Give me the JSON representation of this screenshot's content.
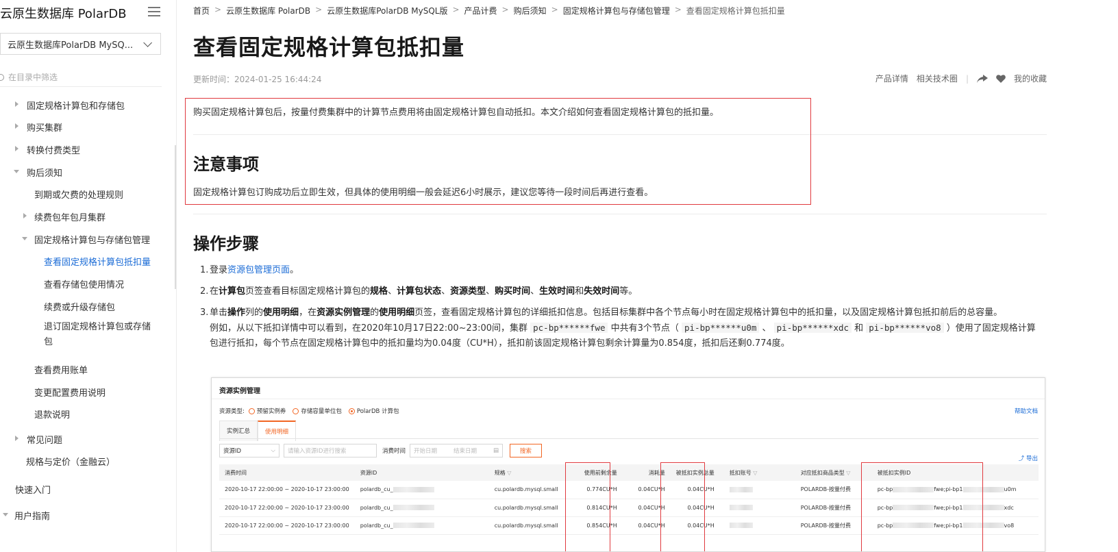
{
  "sidebar": {
    "product_title": "云原生数据库 PolarDB",
    "product_select": "云原生数据库PolarDB MySQ...",
    "filter_placeholder": "在目录中筛选",
    "items": [
      {
        "label": "固定规格计算包和存储包"
      },
      {
        "label": "购买集群"
      },
      {
        "label": "转换付费类型"
      },
      {
        "label": "购后须知"
      },
      {
        "label": "到期或欠费的处理规则"
      },
      {
        "label": "续费包年包月集群"
      },
      {
        "label": "固定规格计算包与存储包管理"
      },
      {
        "label": "查看固定规格计算包抵扣量"
      },
      {
        "label": "查看存储包使用情况"
      },
      {
        "label": "续费或升级存储包"
      },
      {
        "label": "退订固定规格计算包或存储包"
      },
      {
        "label": "查看费用账单"
      },
      {
        "label": "变更配置费用说明"
      },
      {
        "label": "退款说明"
      },
      {
        "label": "常见问题"
      },
      {
        "label": "规格与定价（金融云）"
      },
      {
        "label": "快速入门"
      },
      {
        "label": "用户指南"
      }
    ]
  },
  "breadcrumb": [
    "首页",
    "云原生数据库 PolarDB",
    "云原生数据库PolarDB MySQL版",
    "产品计费",
    "购后须知",
    "固定规格计算包与存储包管理",
    "查看固定规格计算包抵扣量"
  ],
  "page": {
    "title": "查看固定规格计算包抵扣量",
    "updated": "更新时间：2024-01-25 16:44:24",
    "actions": {
      "product_detail": "产品详情",
      "tech_circle": "相关技术圈",
      "favorites": "我的收藏"
    },
    "intro": "购买固定规格计算包后，按量付费集群中的计算节点费用将由固定规格计算包自动抵扣。本文介绍如何查看固定规格计算包的抵扣量。",
    "notes_heading": "注意事项",
    "notes_text": "固定规格计算包订购成功后立即生效，但具体的使用明细一般会延迟6小时展示，建议您等待一段时间后再进行查看。",
    "steps_heading": "操作步骤",
    "steps": {
      "s1_num": "1.",
      "s1_pre": "登录",
      "s1_link": "资源包管理页面",
      "s1_post": "。",
      "s2_num": "2.",
      "s2_a": "在",
      "s2_b": "计算包",
      "s2_c": "页签查看目标固定规格计算包的",
      "s2_d": "规格",
      "s2_e": "、",
      "s2_f": "计算包状态",
      "s2_g": "、",
      "s2_h": "资源类型",
      "s2_i": "、",
      "s2_j": "购买时间",
      "s2_k": "、",
      "s2_l": "生效时间",
      "s2_m": "和",
      "s2_n": "失效时间",
      "s2_o": "等。",
      "s3_num": "3.",
      "s3_a": "单击",
      "s3_b": "操作",
      "s3_c": "列的",
      "s3_d": "使用明细",
      "s3_e": "，在",
      "s3_f": "资源实例管理",
      "s3_g": "的",
      "s3_h": "使用明细",
      "s3_i": "页签，查看固定规格计算包的详细抵扣信息。包括目标集群中各个节点每小时在固定规格计算包中的抵扣量，以及固定规格计算包抵扣前后的总容量。",
      "ex_a": "例如，从以下抵扣详情中可以看到，在2020年10月17日22:00~23:00间，集群 ",
      "ex_code1": "pc-bp******fwe",
      "ex_b": " 中共有3个节点（ ",
      "ex_code2": "pi-bp******u0m",
      "ex_c": " 、 ",
      "ex_code3": "pi-bp******xdc",
      "ex_d": " 和 ",
      "ex_code4": "pi-bp******vo8",
      "ex_e": " ）使用了固定规格计",
      "ex_f": "算包进行抵扣，每个节点在固定规格计算包中的抵扣量均为0.04度（CU*H），抵扣前该固定规格计算包剩余计算量为0.854度，抵扣后还剩0.774度。"
    }
  },
  "screenshot": {
    "title": "资源实例管理",
    "resource_type_label": "资源类型:",
    "radios": [
      "预留实例券",
      "存储容量单位包",
      "PolarDB 计算包"
    ],
    "help": "帮助文档",
    "tabs": [
      "实例汇总",
      "使用明细"
    ],
    "filter_field": "资源ID",
    "filter_placeholder": "请输入资源ID进行搜索",
    "time_label": "消费时间",
    "start_ph": "开始日期",
    "end_ph": "结束日期",
    "search_btn": "搜索",
    "export": "导出",
    "columns": [
      "消费时间",
      "资源ID",
      "规格",
      "使用前剩余量",
      "消耗量",
      "被抵扣实例总量",
      "抵扣账号",
      "对应抵扣商品类型",
      "被抵扣实例ID"
    ],
    "rows": [
      {
        "time": "2020-10-17 22:00:00 ~ 2020-10-17 23:00:00",
        "rid": "polardb_cu_",
        "spec": "cu.polardb.mysql.small",
        "before": "0.774CU*H",
        "used": "0.04CU*H",
        "total": "0.04CU*H",
        "type": "POLARDB-按量付费",
        "iid_a": "pc-bp",
        "iid_b": "fwe;pi-bp1",
        "iid_c": "u0m"
      },
      {
        "time": "2020-10-17 22:00:00 ~ 2020-10-17 23:00:00",
        "rid": "polardb_cu_",
        "spec": "cu.polardb.mysql.small",
        "before": "0.814CU*H",
        "used": "0.04CU*H",
        "total": "0.04CU*H",
        "type": "POLARDB-按量付费",
        "iid_a": "pc-bp",
        "iid_b": "fwe;pi-bp1",
        "iid_c": "xdc"
      },
      {
        "time": "2020-10-17 22:00:00 ~ 2020-10-17 23:00:00",
        "rid": "polardb_cu_",
        "spec": "cu.polardb.mysql.small",
        "before": "0.854CU*H",
        "used": "0.04CU*H",
        "total": "0.04CU*H",
        "type": "POLARDB-按量付费",
        "iid_a": "pc-bp",
        "iid_b": "fwe;pi-bp1",
        "iid_c": "vo8"
      }
    ]
  },
  "colors": {
    "link": "#1a6bd6",
    "highlight": "#e0393e",
    "accent": "#f26522"
  }
}
